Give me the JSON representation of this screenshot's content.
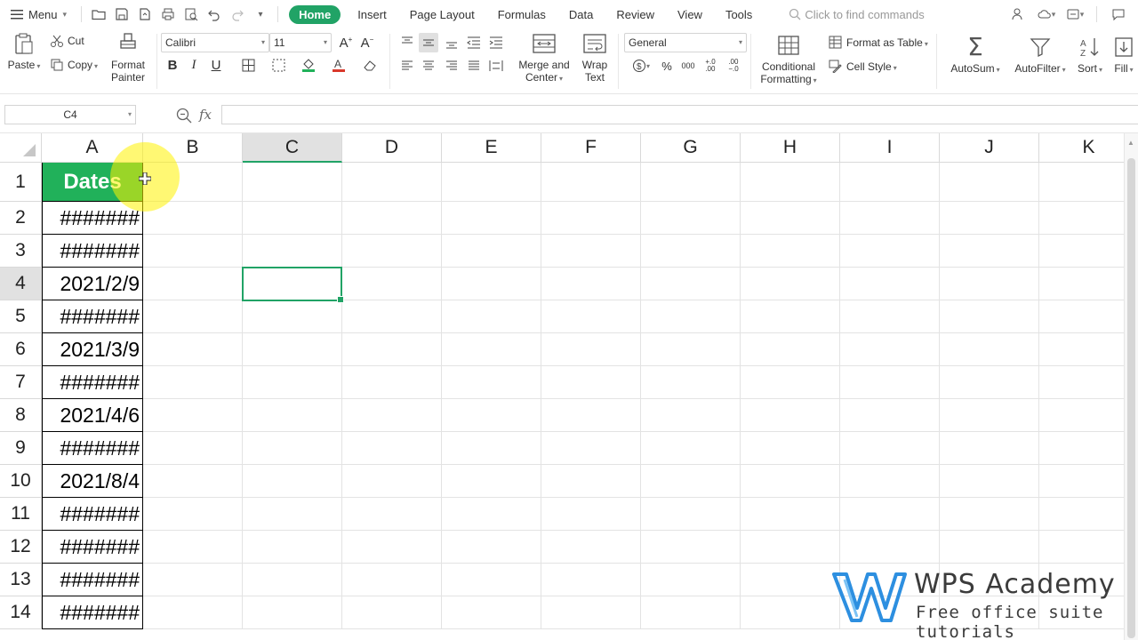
{
  "menubar": {
    "menu_label": "Menu",
    "tabs": [
      {
        "label": "Home",
        "active": true
      },
      {
        "label": "Insert",
        "active": false
      },
      {
        "label": "Page Layout",
        "active": false
      },
      {
        "label": "Formulas",
        "active": false
      },
      {
        "label": "Data",
        "active": false
      },
      {
        "label": "Review",
        "active": false
      },
      {
        "label": "View",
        "active": false
      },
      {
        "label": "Tools",
        "active": false
      }
    ],
    "find_placeholder": "Click to find commands"
  },
  "ribbon": {
    "paste": "Paste",
    "cut": "Cut",
    "copy": "Copy",
    "format_painter_1": "Format",
    "format_painter_2": "Painter",
    "font_name": "Calibri",
    "font_size": "11",
    "merge_1": "Merge and",
    "merge_2": "Center",
    "wrap_1": "Wrap",
    "wrap_2": "Text",
    "number_format": "General",
    "conditional_1": "Conditional",
    "conditional_2": "Formatting",
    "format_as_table": "Format as Table",
    "cell_style": "Cell Style",
    "autosum": "AutoSum",
    "autofilter": "AutoFilter",
    "sort": "Sort",
    "fill": "Fill"
  },
  "formula_bar": {
    "name_box": "C4",
    "fx": "fx",
    "content": ""
  },
  "sheet": {
    "columns": [
      "A",
      "B",
      "C",
      "D",
      "E",
      "F",
      "G",
      "H",
      "I",
      "J",
      "K"
    ],
    "selected_column": "C",
    "selected_row": "4",
    "rows": [
      {
        "num": "1",
        "a": "Dates"
      },
      {
        "num": "2",
        "a": "#######"
      },
      {
        "num": "3",
        "a": "#######"
      },
      {
        "num": "4",
        "a": "2021/2/9"
      },
      {
        "num": "5",
        "a": "#######"
      },
      {
        "num": "6",
        "a": "2021/3/9"
      },
      {
        "num": "7",
        "a": "#######"
      },
      {
        "num": "8",
        "a": "2021/4/6"
      },
      {
        "num": "9",
        "a": "#######"
      },
      {
        "num": "10",
        "a": "2021/8/4"
      },
      {
        "num": "11",
        "a": "#######"
      },
      {
        "num": "12",
        "a": "#######"
      },
      {
        "num": "13",
        "a": "#######"
      },
      {
        "num": "14",
        "a": "#######"
      }
    ]
  },
  "watermark": {
    "title": "WPS Academy",
    "subtitle": "Free office suite tutorials"
  },
  "colors": {
    "accent": "#21a366",
    "header_fill": "#21b15a",
    "highlight": "#fff200",
    "logo_blue": "#2d8fe0"
  }
}
